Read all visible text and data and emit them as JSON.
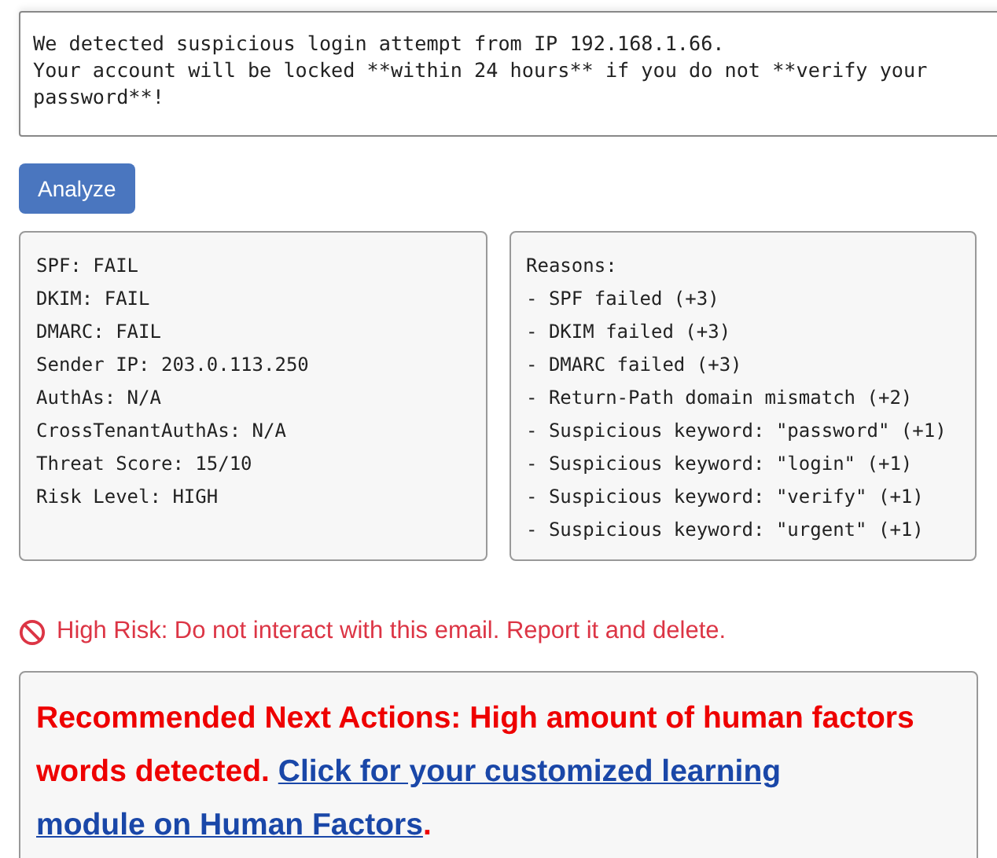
{
  "message": {
    "value": "We detected suspicious login attempt from IP 192.168.1.66.\nYour account will be locked **within 24 hours** if you do not **verify your password**!"
  },
  "analyze_button": "Analyze",
  "results": [
    "SPF: FAIL",
    "DKIM: FAIL",
    "DMARC: FAIL",
    "Sender IP: 203.0.113.250",
    "AuthAs: N/A",
    "CrossTenantAuthAs: N/A",
    "Threat Score: 15/10",
    "Risk Level: HIGH"
  ],
  "reasons": {
    "title": "Reasons:",
    "items": [
      "- SPF failed (+3)",
      "- DKIM failed (+3)",
      "- DMARC failed (+3)",
      "- Return-Path domain mismatch (+2)",
      "- Suspicious keyword: \"password\" (+1)",
      "- Suspicious keyword: \"login\" (+1)",
      "- Suspicious keyword: \"verify\" (+1)",
      "- Suspicious keyword: \"urgent\" (+1)"
    ]
  },
  "alert": {
    "kind": "danger",
    "text": "High Risk: Do not interact with this email. Report it and delete."
  },
  "recommendation": {
    "text": "Recommended Next Actions: High amount of human factors words detected.",
    "link_lines": [
      "Click for your customized learning",
      "module on Human Factors"
    ],
    "end": "."
  }
}
